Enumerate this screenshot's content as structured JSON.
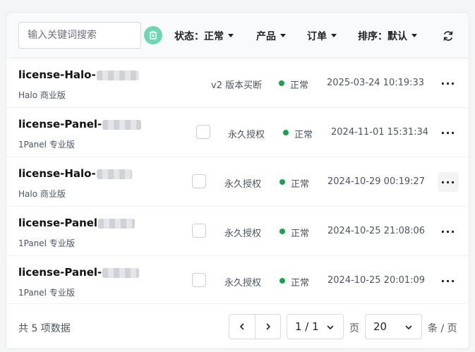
{
  "toolbar": {
    "search_placeholder": "输入关键词搜索",
    "filters": {
      "status_label": "状态：",
      "status_value": "正常",
      "product_label": "产品",
      "order_label": "订单",
      "sort_label": "排序：",
      "sort_value": "默认"
    },
    "icons": [
      "clear-filter-icon",
      "caret-down-icon",
      "refresh-icon"
    ]
  },
  "licenses": [
    {
      "name": "license-Halo-",
      "product": "Halo 商业版",
      "plan": "v2 版本买断",
      "status": "正常",
      "time": "2025-03-24 10:19:33",
      "has_checkbox": false
    },
    {
      "name": "license-Panel-",
      "product": "1Panel 专业版",
      "plan": "永久授权",
      "status": "正常",
      "time": "2024-11-01 15:31:34",
      "has_checkbox": true
    },
    {
      "name": "license-Halo-",
      "product": "Halo 商业版",
      "plan": "永久授权",
      "status": "正常",
      "time": "2024-10-29 00:19:27",
      "has_checkbox": true
    },
    {
      "name": "license-Panel",
      "product": "1Panel 专业版",
      "plan": "永久授权",
      "status": "正常",
      "time": "2024-10-25 21:08:06",
      "has_checkbox": true
    },
    {
      "name": "license-Panel-",
      "product": "1Panel 专业版",
      "plan": "永久授权",
      "status": "正常",
      "time": "2024-10-25 20:01:09",
      "has_checkbox": true
    }
  ],
  "more_label": "···",
  "footer": {
    "total": "共 5 项数据",
    "page_value": "1 / 1",
    "page_unit": "页",
    "page_size_value": "20",
    "page_size_unit": "条 / 页"
  },
  "colors": {
    "accent": "#6fd6b3",
    "status_ok": "#16a34a"
  }
}
